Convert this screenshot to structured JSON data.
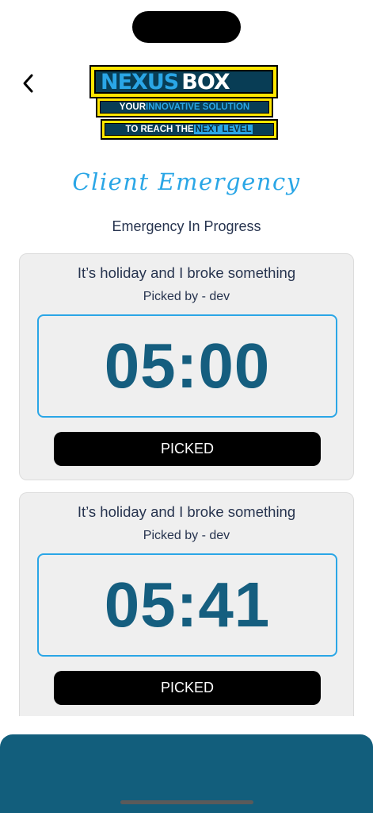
{
  "header": {
    "back_icon": "chevron-left-icon",
    "logo": {
      "word1": "NEXUS",
      "word2": "BOX",
      "line1_part1": "YOUR ",
      "line1_part2": "INNOVATIVE SOLUTION",
      "line2_part1": "TO REACH THE ",
      "line2_part2": "NEXT LEVEL"
    }
  },
  "page": {
    "title": "Client Emergency",
    "section_title": "Emergency In Progress"
  },
  "emergencies": [
    {
      "title": "It’s holiday and I broke something",
      "picked_by": "Picked by - dev",
      "timer": "05:00",
      "button_label": "PICKED"
    },
    {
      "title": "It’s holiday and I broke something",
      "picked_by": "Picked by - dev",
      "timer": "05:41",
      "button_label": "PICKED"
    }
  ],
  "colors": {
    "accent": "#2aa6e6",
    "timer_text": "#155e7f",
    "bottom_panel": "#125e7c",
    "text": "#27344f"
  }
}
